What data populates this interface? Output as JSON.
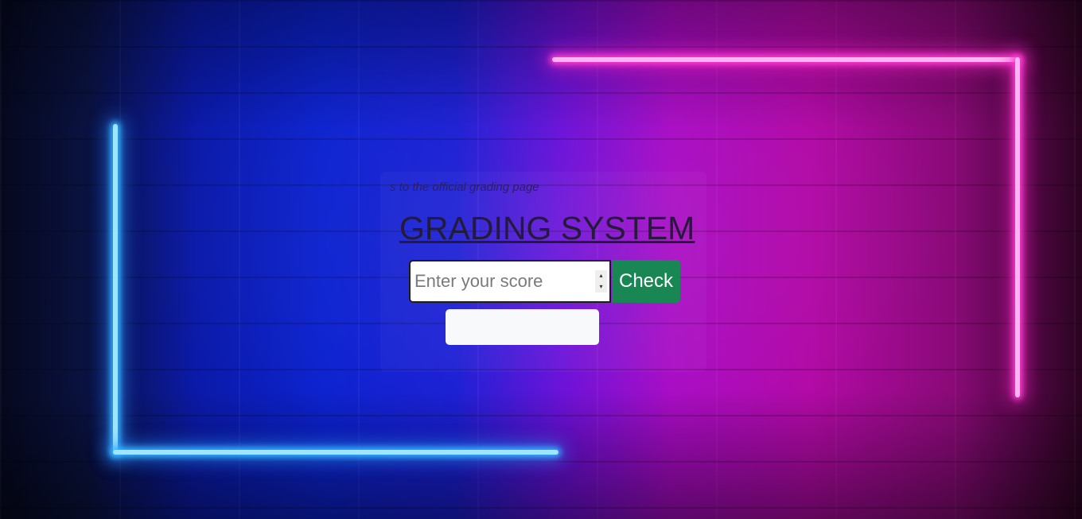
{
  "page": {
    "subtitle": "s to the official grading page",
    "title": "GRADING SYSTEM"
  },
  "form": {
    "score_placeholder": "Enter your score",
    "score_value": "",
    "check_label": "Check",
    "result_text": ""
  },
  "icons": {
    "spinner_up": "▴",
    "spinner_down": "▾"
  },
  "colors": {
    "check_button": "#198754",
    "neon_blue": "#38b6ff",
    "neon_pink": "#ff3fd2",
    "result_box": "#f8f9fa"
  }
}
